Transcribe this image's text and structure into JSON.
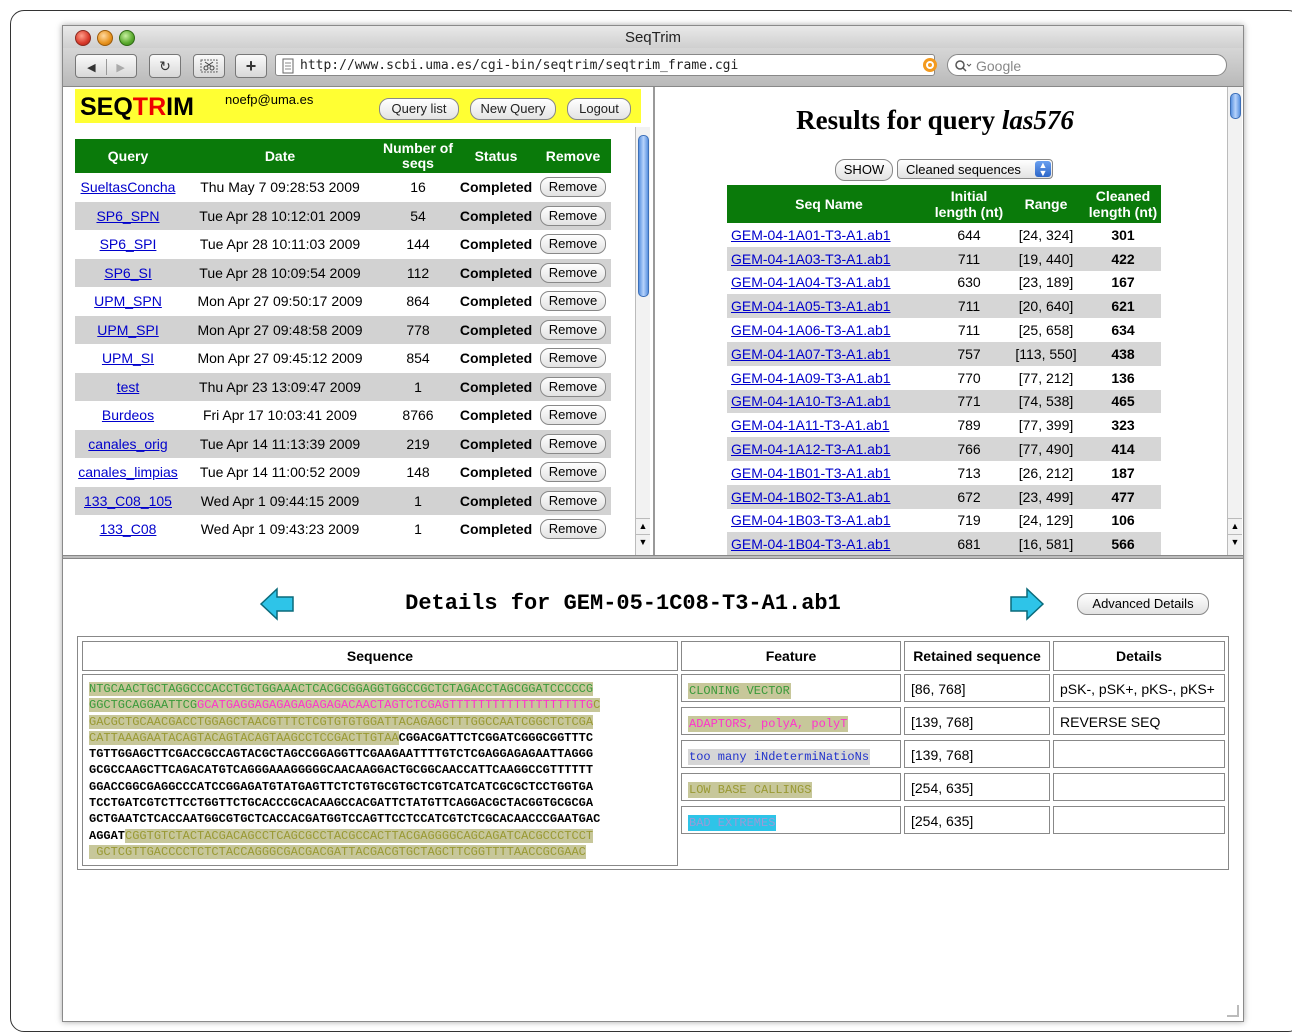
{
  "window": {
    "title": "SeqTrim"
  },
  "toolbar": {
    "url": "http://www.scbi.uma.es/cgi-bin/seqtrim/seqtrim_frame.cgi",
    "search_placeholder": "Google",
    "back_label": "◀",
    "forward_label": "▶",
    "reload_label": "↻",
    "add_label": "+"
  },
  "left": {
    "logo_a": "SEQ",
    "logo_b": "TR",
    "logo_c": "IM",
    "email": "noefp@uma.es",
    "buttons": {
      "query_list": "Query list",
      "new_query": "New Query",
      "logout": "Logout"
    },
    "headers": {
      "query": "Query",
      "date": "Date",
      "num_line1": "Number of",
      "num_line2": "seqs",
      "status": "Status",
      "remove": "Remove"
    },
    "rows": [
      {
        "query": "SueltasConcha",
        "date": "Thu May 7 09:28:53 2009",
        "num": "16",
        "status": "Completed",
        "remove": "Remove"
      },
      {
        "query": "SP6_SPN",
        "date": "Tue Apr 28 10:12:01 2009",
        "num": "54",
        "status": "Completed",
        "remove": "Remove"
      },
      {
        "query": "SP6_SPI",
        "date": "Tue Apr 28 10:11:03 2009",
        "num": "144",
        "status": "Completed",
        "remove": "Remove"
      },
      {
        "query": "SP6_SI",
        "date": "Tue Apr 28 10:09:54 2009",
        "num": "112",
        "status": "Completed",
        "remove": "Remove"
      },
      {
        "query": "UPM_SPN",
        "date": "Mon Apr 27 09:50:17 2009",
        "num": "864",
        "status": "Completed",
        "remove": "Remove"
      },
      {
        "query": "UPM_SPI",
        "date": "Mon Apr 27 09:48:58 2009",
        "num": "778",
        "status": "Completed",
        "remove": "Remove"
      },
      {
        "query": "UPM_SI",
        "date": "Mon Apr 27 09:45:12 2009",
        "num": "854",
        "status": "Completed",
        "remove": "Remove"
      },
      {
        "query": "test",
        "date": "Thu Apr 23 13:09:47 2009",
        "num": "1",
        "status": "Completed",
        "remove": "Remove"
      },
      {
        "query": "Burdeos",
        "date": "Fri Apr 17 10:03:41 2009",
        "num": "8766",
        "status": "Completed",
        "remove": "Remove"
      },
      {
        "query": "canales_orig",
        "date": "Tue Apr 14 11:13:39 2009",
        "num": "219",
        "status": "Completed",
        "remove": "Remove"
      },
      {
        "query": "canales_limpias",
        "date": "Tue Apr 14 11:00:52 2009",
        "num": "148",
        "status": "Completed",
        "remove": "Remove"
      },
      {
        "query": "133_C08_105",
        "date": "Wed Apr 1 09:44:15 2009",
        "num": "1",
        "status": "Completed",
        "remove": "Remove"
      },
      {
        "query": "133_C08",
        "date": "Wed Apr 1 09:43:23 2009",
        "num": "1",
        "status": "Completed",
        "remove": "Remove"
      }
    ]
  },
  "right": {
    "title_prefix": "Results for query ",
    "title_query": "las576",
    "show_label": "SHOW",
    "select_value": "Cleaned sequences",
    "headers": {
      "name": "Seq Name",
      "initial_1": "Initial",
      "initial_2": "length (nt)",
      "range": "Range",
      "cleaned_1": "Cleaned",
      "cleaned_2": "length (nt)"
    },
    "rows": [
      {
        "name": "GEM-04-1A01-T3-A1.ab1",
        "initial": "644",
        "range": "[24, 324]",
        "cleaned": "301"
      },
      {
        "name": "GEM-04-1A03-T3-A1.ab1",
        "initial": "711",
        "range": "[19, 440]",
        "cleaned": "422"
      },
      {
        "name": "GEM-04-1A04-T3-A1.ab1",
        "initial": "630",
        "range": "[23, 189]",
        "cleaned": "167"
      },
      {
        "name": "GEM-04-1A05-T3-A1.ab1",
        "initial": "711",
        "range": "[20, 640]",
        "cleaned": "621"
      },
      {
        "name": "GEM-04-1A06-T3-A1.ab1",
        "initial": "711",
        "range": "[25, 658]",
        "cleaned": "634"
      },
      {
        "name": "GEM-04-1A07-T3-A1.ab1",
        "initial": "757",
        "range": "[113, 550]",
        "cleaned": "438"
      },
      {
        "name": "GEM-04-1A09-T3-A1.ab1",
        "initial": "770",
        "range": "[77, 212]",
        "cleaned": "136"
      },
      {
        "name": "GEM-04-1A10-T3-A1.ab1",
        "initial": "771",
        "range": "[74, 538]",
        "cleaned": "465"
      },
      {
        "name": "GEM-04-1A11-T3-A1.ab1",
        "initial": "789",
        "range": "[77, 399]",
        "cleaned": "323"
      },
      {
        "name": "GEM-04-1A12-T3-A1.ab1",
        "initial": "766",
        "range": "[77, 490]",
        "cleaned": "414"
      },
      {
        "name": "GEM-04-1B01-T3-A1.ab1",
        "initial": "713",
        "range": "[26, 212]",
        "cleaned": "187"
      },
      {
        "name": "GEM-04-1B02-T3-A1.ab1",
        "initial": "672",
        "range": "[23, 499]",
        "cleaned": "477"
      },
      {
        "name": "GEM-04-1B03-T3-A1.ab1",
        "initial": "719",
        "range": "[24, 129]",
        "cleaned": "106"
      },
      {
        "name": "GEM-04-1B04-T3-A1.ab1",
        "initial": "681",
        "range": "[16, 581]",
        "cleaned": "566"
      }
    ]
  },
  "details": {
    "title": "Details for GEM-05-1C08-T3-A1.ab1",
    "advanced_label": "Advanced Details",
    "seq_header": "Sequence",
    "feature_header": "Feature",
    "retained_header": "Retained sequence",
    "details_header": "Details",
    "sequence_segments": [
      {
        "cls": "cl",
        "text": "NTGCAACTGCTAGGCCCACCTGCTGGAAACTCACGCGGAGGTGGCCGCTCTAGACCTAGCGGATCCCCCG\nGGCTGCAGGAATTCG"
      },
      {
        "cls": "ad",
        "text": "GCATGAGGAGAGAGAGAGAGACAACTAGTCTCGAGTTTTTTTTTTTTTTTTTTTG"
      },
      {
        "cls": "lb",
        "text": "C\nGACGCTGCAACGACCTGGAGCTAACGTTTCTCGTGTGTGGATTACAGAGCTTTGGCCAATCGGCTCTCGA\nCATTAAAGAATACAGTACAGTACAGTAAGCCTCCGACTTGTAA"
      },
      {
        "cls": "nm",
        "text": "CGGACGATTCTCGGATCGGGCGGTTTC\nTGTTGGAGCTTCGACCGCCAGTACGCTAGCCGGAGGTTCGAAGAATTTTGTCTCGAGGAGAGAATTAGGG\nGCGCCAAGCTTCAGACATGTCAGGGAAAGGGGGCAACAAGGACTGCGGCAACCATTCAAGGCCGTTTTTT\nGGACCGGCGAGGCCCATCCGGAGATGTATGAGTTCTCTGTGCGTGCTCGTCATCATCGCGCTCCTGGTGA\nTCCTGATCGTCTTCCTGGTTCTGCACCCGCACAAGCCACGATTCTATGTTCAGGACGCTACGGTGCGCGA\nGCTGAATCTCACCAATGGCGTGCTCACCACGATGGTCCAGTTCCTCCATCGTCTCGCACAACCCGAATGAC\nAGGAT"
      },
      {
        "cls": "lb",
        "text": "CGGTGTCTACTACGACAGCCTCAGCGCCTACGCCACTTACGAGGGGCAGCAGATCACGCCCTCCT\n GCTCGTTGACCCCTCTCTACCAGGGCGACGACGATTACGACGTGCTAGCTTCGGTTTTAACCGCGAAC"
      }
    ],
    "features": [
      {
        "label": "CLONING VECTOR",
        "style": "ft-clone",
        "retained": "[86, 768]",
        "details": "pSK-, pSK+, pKS-, pKS+"
      },
      {
        "label": "ADAPTORS, polyA, polyT",
        "style": "ft-adapt",
        "retained": "[139, 768]",
        "details": "REVERSE SEQ"
      },
      {
        "label": "too many iNdetermiNatioNs",
        "style": "ft-nd",
        "retained": "[139, 768]",
        "details": ""
      },
      {
        "label": "LOW BASE CALLINGS",
        "style": "ft-low",
        "retained": "[254, 635]",
        "details": ""
      },
      {
        "label": "BAD EXTREMES",
        "style": "ft-bad",
        "retained": "[254, 635]",
        "details": ""
      }
    ]
  },
  "colors": {
    "header_green": "#0a7a0a",
    "logo_yellow": "#ffff33",
    "link_blue": "#0000cc",
    "cyan_arrow": "#2ec4e8"
  }
}
